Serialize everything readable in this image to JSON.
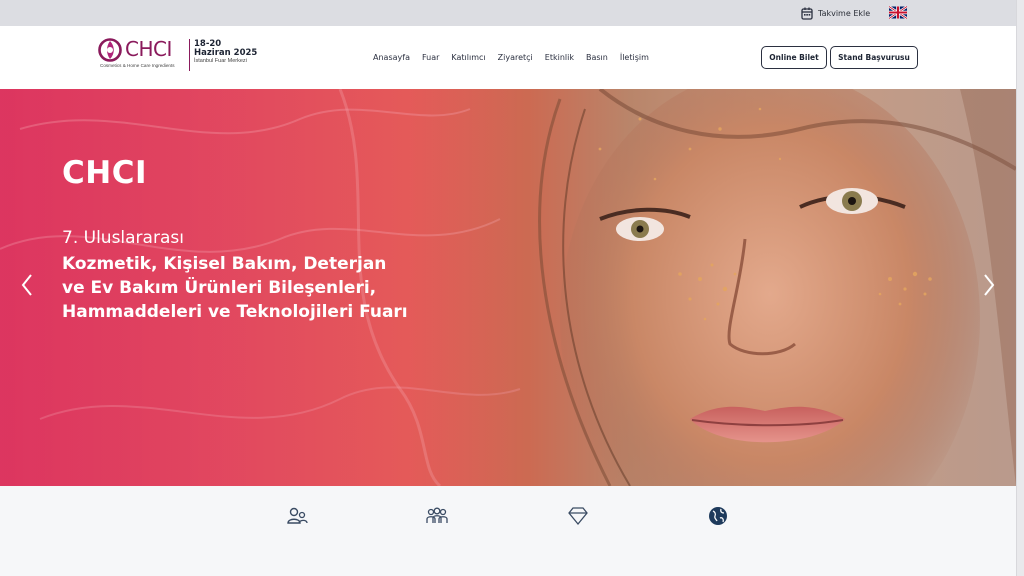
{
  "topbar": {
    "calendar_label": "Takvime Ekle",
    "calendar_icon": "calendar-icon",
    "language_icon": "uk-flag-icon"
  },
  "logo": {
    "wordmark": "CHCI",
    "tagline": "Cosmetics & Home Care Ingredients",
    "dates": "18-20",
    "month_year": "Haziran 2025",
    "venue": "İstanbul Fuar Merkezi"
  },
  "nav": {
    "items": [
      "Anasayfa",
      "Fuar",
      "Katılımcı",
      "Ziyaretçi",
      "Etkinlik",
      "Basın",
      "İletişim"
    ]
  },
  "buttons": {
    "ticket": "Online Bilet",
    "stand": "Stand Başvurusu"
  },
  "hero": {
    "title": "CHCI",
    "kicker": "7. Uluslararası",
    "lines": [
      "Kozmetik, Kişisel Bakım, Deterjan",
      "ve Ev Bakım Ürünleri Bileşenleri,",
      "Hammaddeleri ve Teknolojileri Fuarı"
    ],
    "prev_icon": "chevron-left-icon",
    "next_icon": "chevron-right-icon"
  },
  "features": {
    "icons": [
      "visitors-icon",
      "participants-icon",
      "diamond-icon",
      "globe-icon"
    ]
  },
  "colors": {
    "brand": "#8a1a5c",
    "dark": "#1d2433",
    "topbar": "#dcdde2"
  }
}
